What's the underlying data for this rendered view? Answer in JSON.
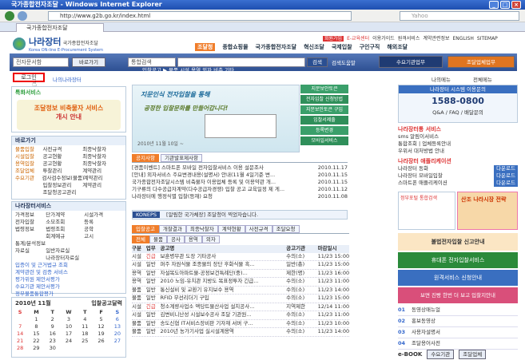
{
  "window": {
    "title": "국가종합전자조달 - Windows Internet Explorer",
    "url": "http://www.g2b.go.kr/index.html",
    "search_placeholder": "Yahoo",
    "tab": "국가종합전자조달"
  },
  "header": {
    "logo_main": "나라장터",
    "logo_sub": "국가종합전자조달",
    "logo_en": "Korea ON-line E-Procurement System",
    "top_links": [
      "이용가이드",
      "원격서비스",
      "계약관련정보",
      "영문/중문",
      "ENGLISH",
      "SITEMAP"
    ],
    "top_red": [
      "회원가입",
      "E-교육센터"
    ],
    "nav": [
      "조달청",
      "종합쇼핑몰",
      "국가종합전자조달",
      "혁신조달",
      "국제입찰",
      "구인구직",
      "해외조달"
    ]
  },
  "searchbar": {
    "select1": "전자문서함",
    "btn1": "바로가기",
    "select2": "통합검색",
    "btn2": "검색",
    "btn3": "검색도움말",
    "btn4": "수요기관업무",
    "btn5": "조달업체업무"
  },
  "login": {
    "label": "로그인",
    "label2": "나의나라장터"
  },
  "breadcrumb": "입찰공고 ▶ 물품 시설 용역 외자 비축 기타",
  "banner": {
    "line1": "지문인식 전자입찰을 통해",
    "line2": "공정한 입찰문화를 만들어갑니다!",
    "date": "2010년 11월 10일 ~",
    "tag": "지문인식전자입찰제도 도입"
  },
  "banner_menu": [
    "지문보안토큰",
    "전자입찰 신청방법",
    "지문보안토큰 구입",
    "입찰서제출",
    "등록변경",
    "모바일서비스"
  ],
  "left_box": {
    "title": "특화서비스",
    "banner": "조달정보 비축물자 서비스",
    "sub": "개시 안내"
  },
  "left_links": {
    "title": "바로가기",
    "items": [
      [
        "물품입찰",
        "사전규격",
        "최종낙찰자"
      ],
      [
        "시설입찰",
        "공고현황",
        "최종낙찰자"
      ],
      [
        "용역입찰",
        "공고현황",
        "최종낙찰자"
      ],
      [
        "조달업체",
        "투찰관리",
        "계약관리"
      ],
      [
        "수요기관",
        "검사검수정보(물품)",
        "계약관리"
      ],
      [
        "",
        "입찰정보관리",
        "계약관리"
      ],
      [
        "",
        "조달청공고관리",
        ""
      ]
    ]
  },
  "left_service": {
    "title": "나라장터서비스",
    "items": [
      [
        "가격정보",
        "단가계약",
        "시설가격"
      ],
      [
        "전자입찰",
        "소모조회",
        "등록"
      ],
      [
        "법령정보",
        "법령조회",
        "공학"
      ],
      [
        "",
        "회계예규",
        "고시"
      ],
      [
        "통계/분석정보",
        "",
        ""
      ],
      [
        "자료실",
        "일반자료실",
        ""
      ],
      [
        "",
        "나라장터자료실",
        ""
      ]
    ],
    "bullets": [
      "입증이 및 근거법규 조회",
      "계약관련 및 검증 서비스",
      "평가위원 제안서평가",
      "수요기관 제안서평가",
      "정부물품통합평가"
    ]
  },
  "calendar": {
    "title": "2010년 11월",
    "label": "입찰공고달력",
    "days": [
      "S",
      "M",
      "T",
      "W",
      "T",
      "F",
      "S"
    ],
    "weeks": [
      [
        "",
        "1",
        "2",
        "3",
        "4",
        "5",
        "6"
      ],
      [
        "7",
        "8",
        "9",
        "10",
        "11",
        "12",
        "13"
      ],
      [
        "14",
        "15",
        "16",
        "17",
        "18",
        "19",
        "20"
      ],
      [
        "21",
        "22",
        "23",
        "24",
        "25",
        "26",
        "27"
      ],
      [
        "28",
        "29",
        "30",
        "",
        "",
        "",
        ""
      ]
    ]
  },
  "notices": {
    "tabs": [
      "공지사항",
      "기관발표제사항"
    ],
    "items": [
      {
        "t": "[경품이벤트] 스마트폰 모바일 전자입찰서비스 이용 설문조사",
        "d": "2010.11.17"
      },
      {
        "t": "[안내] 외자서비스 주요변경내용(설명서) 안내(11월 4일기준 변...",
        "d": "2010.11.15"
      },
      {
        "t": "국가종합전자조달시스템 비축물자 이용업체 등록 및 이용약관 개...",
        "d": "2010.11.15"
      },
      {
        "t": "기구류의 다수공급자계약(다수공급자경쟁) 입찰 공고 교육일정 제 게...",
        "d": "2010.11.12"
      },
      {
        "t": "나라장터에 행정식별 입찰(등재) 요청",
        "d": "2010.11.08"
      }
    ]
  },
  "koneps": {
    "label": "KONEPS",
    "text": "[알림한 국가체장] 조달청이 찍었자습니다."
  },
  "bids": {
    "tabs": [
      "입찰공고",
      "개찰결과",
      "최종낙찰자",
      "계약현황",
      "사전규격",
      "조달요청"
    ],
    "subtabs": [
      "전체",
      "물품",
      "공사",
      "용역",
      "외자"
    ],
    "headers": [
      "구분",
      "업무",
      "공고명",
      "공고기관",
      "마감일시"
    ],
    "rows": [
      [
        "시설",
        "긴급",
        "보훈병무관 도장 기타공사",
        "수의(소)",
        "11/23 15:00"
      ],
      [
        "시설",
        "일반",
        "퍼주 자원식물 조종물의 장단 후화식물 흑...",
        "일반(총)",
        "11/23 15:00"
      ],
      [
        "용역",
        "일반",
        "자설복도아파트물-공정보건특례단(중)...",
        "제한(명)",
        "11/23 16:00"
      ],
      [
        "용역",
        "일반",
        "2010 노임-유치관 지방도 목표정투자 긴급...",
        "수의(소)",
        "11/23 11:00"
      ],
      [
        "물품",
        "일반",
        "통신설비 및 교환기 유지보수 용역",
        "수의(소)",
        "11/23 14:00"
      ],
      [
        "물품",
        "일반",
        "RFID 무선리더기 구입",
        "수의(소)",
        "11/23 15:00"
      ],
      [
        "시설",
        "긴급",
        "청소계량사업소 액당트물산사업 설치공사...",
        "지역제한",
        "12/14 11:00"
      ],
      [
        "시설",
        "일반",
        "김변비니난성 시설보수공사 조달 기관원...",
        "수의(소)",
        "11/23 11:00"
      ],
      [
        "물품",
        "일반",
        "송도신협 IT서비스장비판 기자재 서버 구...",
        "수의(소)",
        "11/23 10:00"
      ],
      [
        "물품",
        "일반",
        "2010년 농가기사업 실시설계용역",
        "수의(소)",
        "11/23 14:00"
      ]
    ]
  },
  "right": {
    "center_title": "나라장터 시스템 이용문의",
    "phone": "1588-0800",
    "faq": "Q&A / FAQ / 배달문의",
    "services_title": "나라장터통 서비스",
    "services": [
      "sms 알림이서비스",
      "통합조회 | 업체등록안내",
      "우위서 대처방법 안내"
    ],
    "app_title": "나라장터 애플리케이션",
    "apps": [
      "나라장터 동화",
      "나라장터 모바일입찰",
      "스마트폰 애플리케이션"
    ],
    "btn_down": "다운로드",
    "btn_guide": "메뉴얼",
    "promo1": "정부포털 통합검색",
    "promo2": "산조 나라시장 전략",
    "banner3": "불법전자입찰 신고안내",
    "banner4": "휴대폰 전자입찰서비스",
    "banner5": "원격서비스 신청안내",
    "banner6": "보면 진빵 한번 더 보고 입찰지안내",
    "links": [
      {
        "n": "01",
        "t": "동영상매뉴얼"
      },
      {
        "n": "02",
        "t": "홍보동영상"
      },
      {
        "n": "03",
        "t": "사용자설명서"
      },
      {
        "n": "04",
        "t": "조달용어사전"
      }
    ],
    "ebook": "e-BOOK",
    "ebook_b1": "수요기관",
    "ebook_b2": "조달업체"
  },
  "misc": {
    "user_select": "나의메뉴",
    "view_select": "전체메뉴",
    "nav_home": "조달청"
  }
}
